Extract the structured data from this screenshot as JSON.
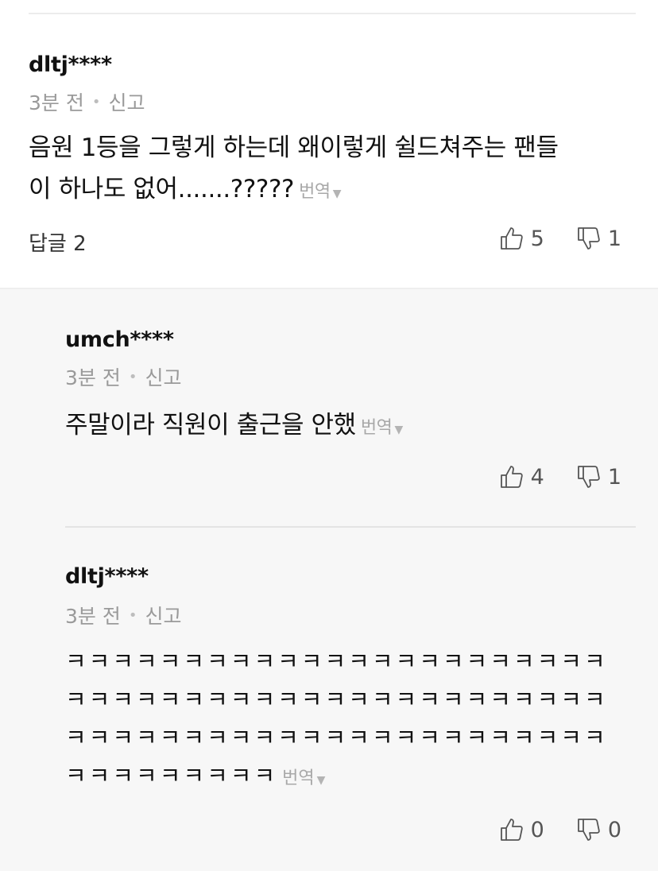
{
  "main_comment": {
    "author": "dltj****",
    "time": "3분 전",
    "report_label": "신고",
    "text_line1": "음원 1등을 그렇게 하는데 왜이렇게 쉴드쳐주는 팬들",
    "text_line2": "이 하나도 없어.......?????",
    "translate_label": "번역",
    "replies_label": "답글 2",
    "likes": "5",
    "dislikes": "1"
  },
  "replies": [
    {
      "author": "umch****",
      "time": "3분 전",
      "report_label": "신고",
      "text": "주말이라 직원이 출근을 안했",
      "translate_label": "번역",
      "likes": "4",
      "dislikes": "1"
    },
    {
      "author": "dltj****",
      "time": "3분 전",
      "report_label": "신고",
      "text_lines": [
        "ㅋㅋㅋㅋㅋㅋㅋㅋㅋㅋㅋㅋㅋㅋㅋㅋㅋㅋㅋㅋㅋㅋㅋ",
        "ㅋㅋㅋㅋㅋㅋㅋㅋㅋㅋㅋㅋㅋㅋㅋㅋㅋㅋㅋㅋㅋㅋㅋ",
        "ㅋㅋㅋㅋㅋㅋㅋㅋㅋㅋㅋㅋㅋㅋㅋㅋㅋㅋㅋㅋㅋㅋㅋ",
        "ㅋㅋㅋㅋㅋㅋㅋㅋㅋ"
      ],
      "translate_label": "번역",
      "likes": "0",
      "dislikes": "0"
    }
  ],
  "icons": {
    "like": "thumbs-up-icon",
    "dislike": "thumbs-down-icon",
    "caret": "caret-down-icon"
  }
}
